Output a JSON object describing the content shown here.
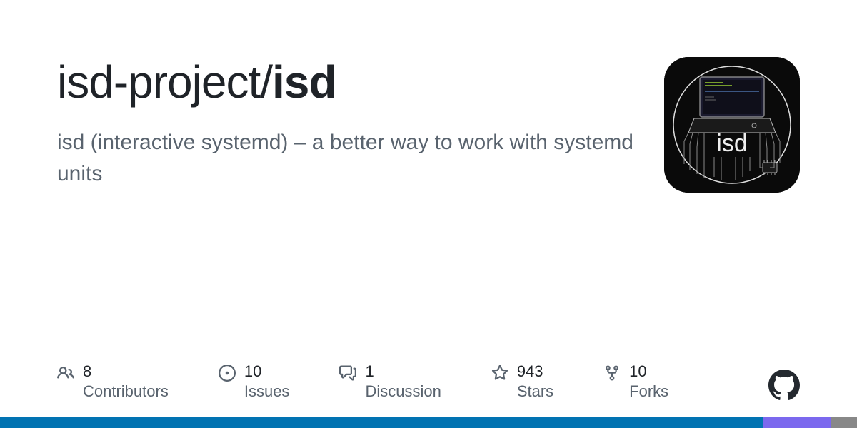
{
  "repo": {
    "owner": "isd-project",
    "separator": "/",
    "name": "isd",
    "description": "isd (interactive systemd) – a better way to work with systemd units",
    "logo_text": "isd"
  },
  "stats": {
    "contributors": {
      "count": "8",
      "label": "Contributors"
    },
    "issues": {
      "count": "10",
      "label": "Issues"
    },
    "discussions": {
      "count": "1",
      "label": "Discussion"
    },
    "stars": {
      "count": "943",
      "label": "Stars"
    },
    "forks": {
      "count": "10",
      "label": "Forks"
    }
  },
  "bottom_bar": {
    "segments": [
      {
        "color": "#0173b2",
        "width": "89%"
      },
      {
        "color": "#7b68ee",
        "width": "8%"
      },
      {
        "color": "#888888",
        "width": "3%"
      }
    ]
  }
}
